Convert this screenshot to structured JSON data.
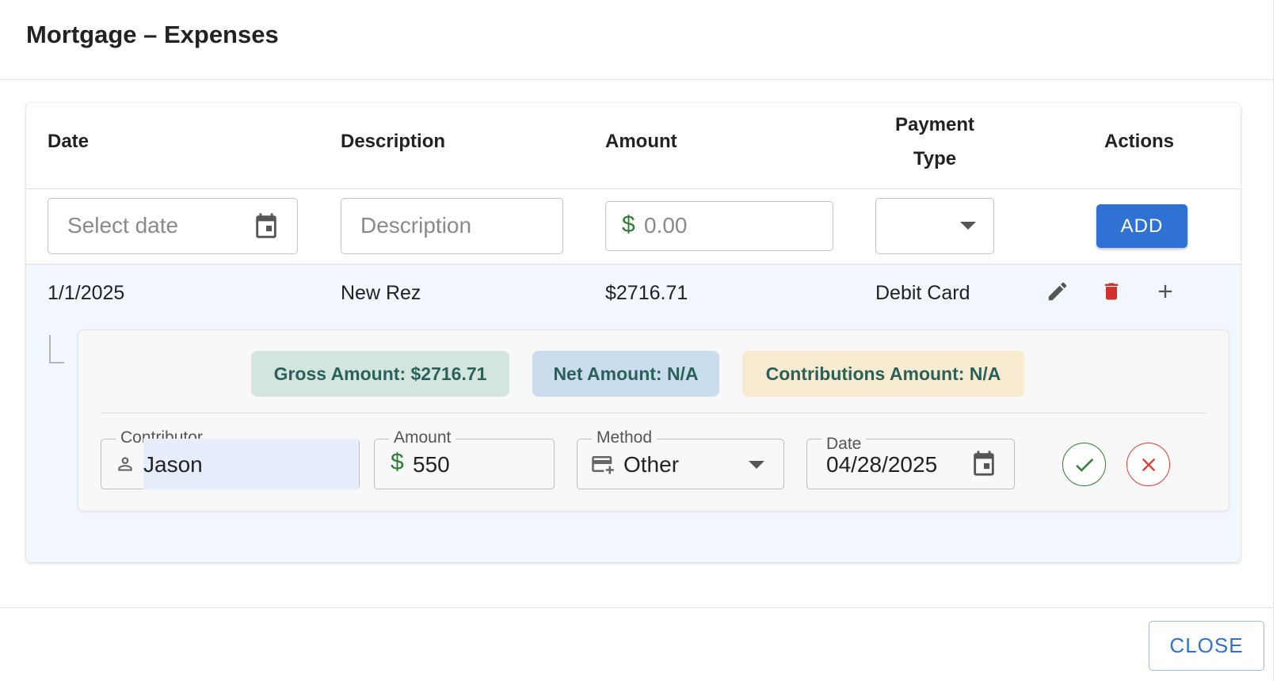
{
  "dialog": {
    "title": "Mortgage – Expenses",
    "close_label": "CLOSE"
  },
  "table": {
    "headers": {
      "date": "Date",
      "description": "Description",
      "amount": "Amount",
      "payment_type_line1": "Payment",
      "payment_type_line2": "Type",
      "actions": "Actions"
    },
    "new_row": {
      "date_placeholder": "Select date",
      "description_placeholder": "Description",
      "amount_placeholder": "0.00",
      "currency_symbol": "$",
      "payment_type_value": "",
      "add_label": "ADD"
    },
    "rows": [
      {
        "date": "1/1/2025",
        "description": "New Rez",
        "amount": "$2716.71",
        "payment_type": "Debit Card"
      }
    ]
  },
  "details": {
    "chips": {
      "gross": "Gross Amount: $2716.71",
      "net": "Net Amount: N/A",
      "contributions": "Contributions Amount: N/A"
    },
    "contribution_form": {
      "contributor_label": "Contributor",
      "contributor_value": "Jason",
      "amount_label": "Amount",
      "amount_currency": "$",
      "amount_value": "550",
      "method_label": "Method",
      "method_value": "Other",
      "date_label": "Date",
      "date_value": "04/28/2025"
    }
  },
  "colors": {
    "primary": "#2f72d3",
    "gross_chip_bg": "#d2e6df",
    "net_chip_bg": "#c9ddef",
    "contrib_chip_bg": "#f7ebd2",
    "chip_text": "#2c6058",
    "delete_red": "#d0312d",
    "confirm_green": "#2e7d32",
    "cancel_red": "#e53935",
    "currency_green": "#2e7d32"
  },
  "icons": [
    "calendar-icon",
    "dropdown-arrow-icon",
    "edit-icon",
    "delete-icon",
    "add-icon",
    "person-icon",
    "payment-method-icon",
    "check-icon",
    "cancel-icon"
  ]
}
